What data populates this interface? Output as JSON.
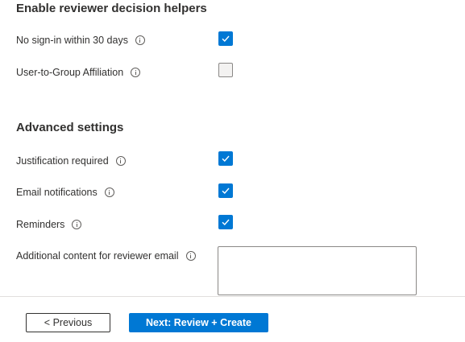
{
  "reviewer_helpers": {
    "heading": "Enable reviewer decision helpers",
    "no_signin": {
      "label": "No sign-in within 30 days",
      "checked": true
    },
    "group_affiliation": {
      "label": "User-to-Group Affiliation",
      "checked": false
    }
  },
  "advanced": {
    "heading": "Advanced settings",
    "justification": {
      "label": "Justification required",
      "checked": true
    },
    "email_notifications": {
      "label": "Email notifications",
      "checked": true
    },
    "reminders": {
      "label": "Reminders",
      "checked": true
    },
    "additional_content": {
      "label": "Additional content for reviewer email",
      "value": ""
    }
  },
  "footer": {
    "previous_label": "< Previous",
    "next_label": "Next: Review + Create"
  },
  "colors": {
    "accent": "#0078d4",
    "text": "#323130",
    "divider": "#e1dfdd"
  },
  "icons": {
    "info": "info-icon",
    "check": "checkmark-icon"
  }
}
